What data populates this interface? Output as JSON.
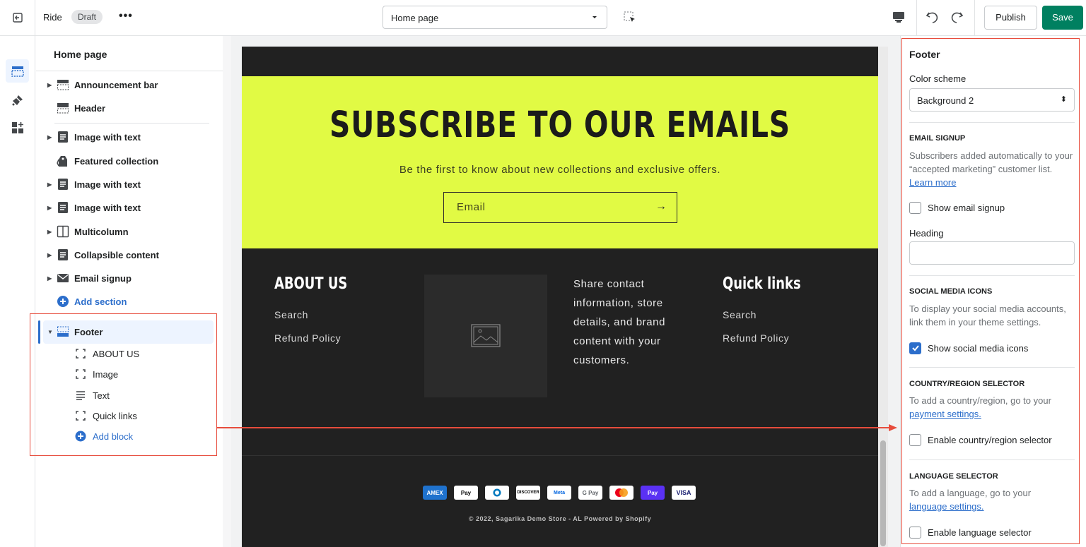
{
  "topbar": {
    "theme_name": "Ride",
    "status_badge": "Draft",
    "more_label": "•••",
    "page_select": "Home page",
    "publish_label": "Publish",
    "save_label": "Save"
  },
  "rail": {
    "items": [
      {
        "icon": "sections-icon",
        "active": true
      },
      {
        "icon": "theme-settings-brush-icon",
        "active": false
      },
      {
        "icon": "apps-blocks-icon",
        "active": false
      }
    ]
  },
  "sidebar": {
    "title": "Home page",
    "sections": [
      {
        "label": "Announcement bar",
        "icon": "announcement-bar-icon",
        "expandable": true
      },
      {
        "label": "Header",
        "icon": "header-icon",
        "expandable": false
      },
      {
        "label": "Image with text",
        "icon": "image-with-text-icon",
        "expandable": true
      },
      {
        "label": "Featured collection",
        "icon": "collection-tag-icon",
        "expandable": false
      },
      {
        "label": "Image with text",
        "icon": "image-with-text-icon",
        "expandable": true
      },
      {
        "label": "Image with text",
        "icon": "image-with-text-icon",
        "expandable": true
      },
      {
        "label": "Multicolumn",
        "icon": "multicolumn-icon",
        "expandable": true
      },
      {
        "label": "Collapsible content",
        "icon": "collapsible-content-icon",
        "expandable": true
      },
      {
        "label": "Email signup",
        "icon": "envelope-icon",
        "expandable": true
      }
    ],
    "add_section": "Add section",
    "footer": {
      "label": "Footer",
      "blocks": [
        {
          "label": "ABOUT US",
          "icon": "block-frame-icon"
        },
        {
          "label": "Image",
          "icon": "block-frame-icon"
        },
        {
          "label": "Text",
          "icon": "text-lines-icon"
        },
        {
          "label": "Quick links",
          "icon": "block-frame-icon"
        }
      ],
      "add_block": "Add block"
    }
  },
  "preview": {
    "subscribe_heading": "SUBSCRIBE TO OUR EMAILS",
    "subscribe_text": "Be the first to know about new collections and exclusive offers.",
    "email_placeholder": "Email",
    "about_heading": "ABOUT US",
    "about_links": [
      "Search",
      "Refund Policy"
    ],
    "contact_text": "Share contact information, store details, and brand content with your customers.",
    "quick_links_heading": "Quick links",
    "quick_links": [
      "Search",
      "Refund Policy"
    ],
    "payment_icons": [
      "AMEX",
      "Apple Pay",
      "Diners",
      "DISCOVER",
      "Meta",
      "G Pay",
      "Mastercard",
      "Shop Pay",
      "VISA"
    ],
    "copyright": "© 2022, Sagarika Demo Store - AL Powered by Shopify"
  },
  "settings": {
    "title": "Footer",
    "color_scheme_label": "Color scheme",
    "color_scheme_value": "Background 2",
    "email_signup": {
      "caption": "EMAIL SIGNUP",
      "help": "Subscribers added automatically to your “accepted marketing” customer list.",
      "link": "Learn more",
      "checkbox_label": "Show email signup",
      "checked": false,
      "heading_label": "Heading",
      "heading_value": ""
    },
    "social": {
      "caption": "SOCIAL MEDIA ICONS",
      "help": "To display your social media accounts, link them in your theme settings.",
      "checkbox_label": "Show social media icons",
      "checked": true
    },
    "country": {
      "caption": "COUNTRY/REGION SELECTOR",
      "help": "To add a country/region, go to your",
      "link": "payment settings.",
      "checkbox_label": "Enable country/region selector",
      "checked": false
    },
    "language": {
      "caption": "LANGUAGE SELECTOR",
      "help": "To add a language, go to your",
      "link": "language settings.",
      "checkbox_label": "Enable language selector",
      "checked": false
    }
  },
  "colors": {
    "accent": "#2c6ecb",
    "save": "#008060",
    "subscribe_bg": "#e1fa44",
    "store_bg": "#212121",
    "annotation": "#e74c3c"
  }
}
